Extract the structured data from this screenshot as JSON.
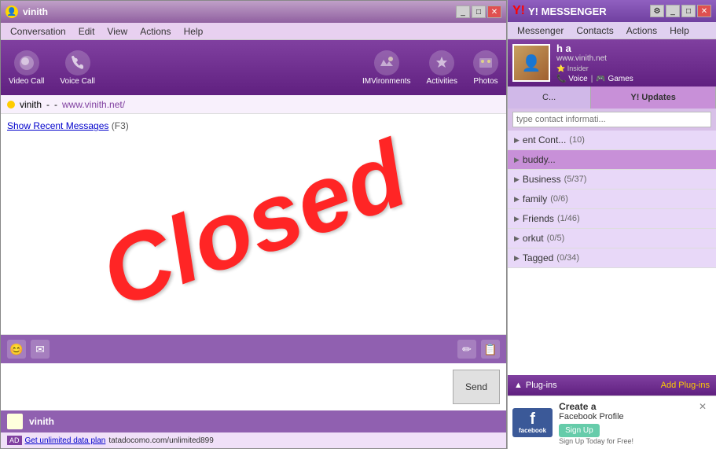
{
  "chat_window": {
    "title": "vinith",
    "title_icon": "👤",
    "menus": [
      "Conversation",
      "Edit",
      "View",
      "Actions",
      "Help"
    ],
    "toolbar": {
      "video_call": "Video Call",
      "voice_call": "Voice Call",
      "imvironments": "IMVironments",
      "activities": "Activities",
      "photos": "Photos"
    },
    "status": {
      "username": "vinith",
      "url": "www.vinith.net/"
    },
    "show_recent": "Show Recent Messages",
    "show_recent_hint": "(F3)",
    "watermark": "Closed",
    "input_tools": [
      "😊",
      "✉",
      "✏",
      "📋"
    ],
    "send_button": "Send",
    "bottom_name": "vinith",
    "ad_label": "AD",
    "ad_text": "Get unlimited data plan",
    "ad_url": "tatadocomo.com/unlimited899"
  },
  "messenger_panel": {
    "title": "Y! MESSENGER",
    "menus": [
      "Messenger",
      "Contacts",
      "Actions",
      "Help"
    ],
    "profile": {
      "name": "h a",
      "url": "www.vinith.net",
      "buttons": [
        "Voice",
        "Games"
      ]
    },
    "tabs": [
      "C...",
      "Y! Updates"
    ],
    "search_placeholder": "type contact informati...",
    "groups": [
      {
        "name": "ent Cont...",
        "count": "(10)",
        "selected": false
      },
      {
        "name": "buddy...",
        "count": "",
        "selected": true
      },
      {
        "name": "Business",
        "count": "(5/37)",
        "selected": false
      },
      {
        "name": "family",
        "count": "(0/6)",
        "selected": false
      },
      {
        "name": "Friends",
        "count": "(1/46)",
        "selected": false
      },
      {
        "name": "orkut",
        "count": "(0/5)",
        "selected": false
      },
      {
        "name": "Tagged",
        "count": "(0/34)",
        "selected": false
      }
    ],
    "plugins_label": "Plug-ins",
    "add_plugins": "Add Plug-ins",
    "fb_ad": {
      "title": "Create a",
      "subtitle": "Facebook Profile",
      "btn": "Sign Up",
      "small": "Sign Up Today for Free!",
      "logo_text": "facebook"
    }
  }
}
